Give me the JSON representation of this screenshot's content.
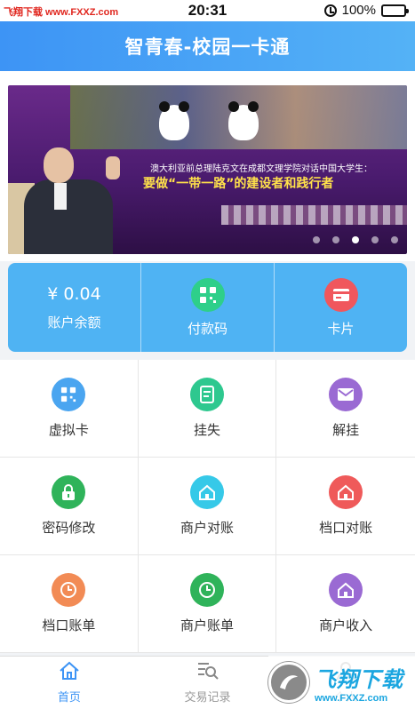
{
  "watermark": {
    "top": "飞翔下载 www.FXXZ.com",
    "bottom_cn": "飞翔下载",
    "bottom_url": "www.FXXZ.com"
  },
  "status_bar": {
    "time": "20:31",
    "battery": "100%"
  },
  "header": {
    "title": "智青春-校园一卡通"
  },
  "banner": {
    "caption_line1": "澳大利亚前总理陆克文在成都文理学院对话中国大学生：",
    "caption_line2": "要做“一带一路”的建设者和践行者",
    "dots": 5,
    "active_dot": 3
  },
  "top_cards": [
    {
      "value": "¥ 0.04",
      "label": "账户余额"
    },
    {
      "label": "付款码",
      "icon": "qr-code-icon",
      "color": "#2ecf8a"
    },
    {
      "label": "卡片",
      "icon": "card-icon",
      "color": "#f0575d"
    }
  ],
  "grid": [
    {
      "label": "虚拟卡",
      "icon": "qr-code-icon",
      "color": "#4aa5f0"
    },
    {
      "label": "挂失",
      "icon": "card-icon",
      "color": "#2ec88f"
    },
    {
      "label": "解挂",
      "icon": "envelope-icon",
      "color": "#9a6ad3"
    },
    {
      "label": "密码修改",
      "icon": "lock-icon",
      "color": "#2fb35a"
    },
    {
      "label": "商户对账",
      "icon": "house-icon",
      "color": "#36c9e8"
    },
    {
      "label": "档口对账",
      "icon": "house-icon",
      "color": "#ef5a5a"
    },
    {
      "label": "档口账单",
      "icon": "clock-icon",
      "color": "#f28b55"
    },
    {
      "label": "商户账单",
      "icon": "clock-icon",
      "color": "#2fb35a"
    },
    {
      "label": "商户收入",
      "icon": "house-icon",
      "color": "#9a6ad3"
    }
  ],
  "tabbar": [
    {
      "label": "首页",
      "icon": "home-icon",
      "active": true
    },
    {
      "label": "交易记录",
      "icon": "search-list-icon",
      "active": false
    },
    {
      "label": "个人",
      "icon": "user-icon",
      "active": false
    }
  ]
}
